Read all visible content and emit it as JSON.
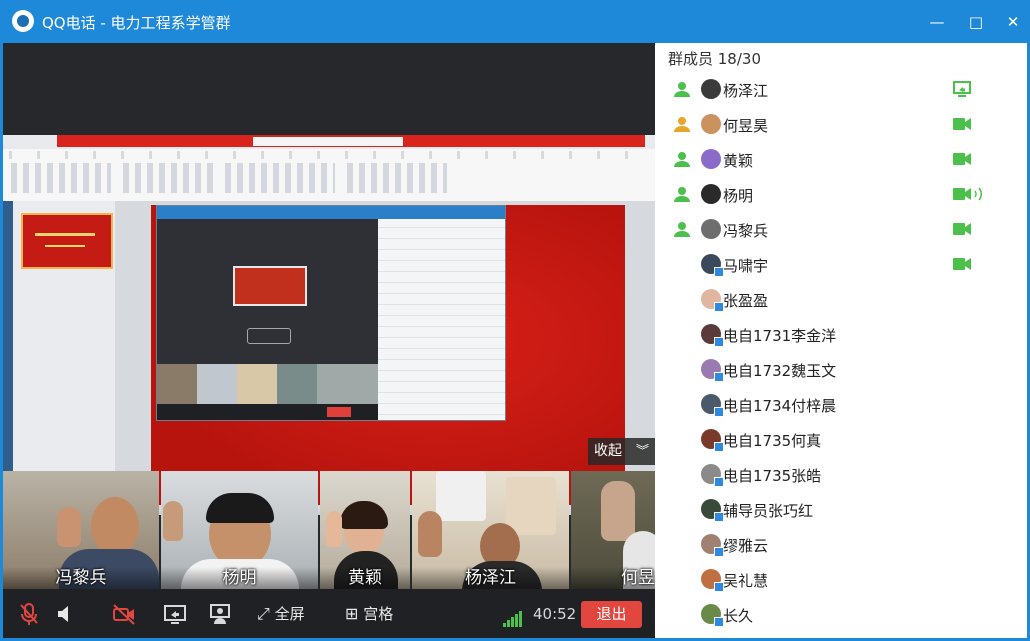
{
  "window": {
    "title": "QQ电话 - 电力工程系学管群",
    "buttons": {
      "minimize": "—",
      "maximize": "□",
      "close": "✕"
    }
  },
  "colors": {
    "accent": "#1d89d8",
    "exit": "#e2473f",
    "online_green": "#4bc14b",
    "away_orange": "#e7a52a"
  },
  "screen_share": {
    "collapse_label": "收起",
    "collapse_icon": "double-chevron-down-icon"
  },
  "video_tiles": [
    {
      "name": "冯黎兵"
    },
    {
      "name": "杨明"
    },
    {
      "name": "黄颖"
    },
    {
      "name": "杨泽江"
    },
    {
      "name": "何昱"
    }
  ],
  "controls": {
    "fullscreen_label": "全屏",
    "grid_label": "宫格",
    "timer": "40:52",
    "exit_label": "退出",
    "icons": [
      "mic-muted-icon",
      "speaker-icon",
      "camera-off-icon",
      "screen-share-icon",
      "presenter-icon",
      "fullscreen-icon",
      "grid-icon",
      "signal-icon"
    ]
  },
  "members": {
    "title": "群成员 18/30",
    "list": [
      {
        "name": "杨泽江",
        "presence": "online",
        "status": "screen-share-icon"
      },
      {
        "name": "何昱昊",
        "presence": "away",
        "status": "camera-icon"
      },
      {
        "name": "黄颖",
        "presence": "online",
        "status": "camera-icon"
      },
      {
        "name": "杨明",
        "presence": "online",
        "status": "camera-speaking-icon"
      },
      {
        "name": "冯黎兵",
        "presence": "online",
        "status": "camera-icon"
      },
      {
        "name": "马啸宇",
        "presence": "",
        "status": "camera-icon"
      },
      {
        "name": "张盈盈",
        "presence": "",
        "status": ""
      },
      {
        "name": "电自1731李金洋",
        "presence": "",
        "status": ""
      },
      {
        "name": "电自1732魏玉文",
        "presence": "",
        "status": ""
      },
      {
        "name": "电自1734付梓晨",
        "presence": "",
        "status": ""
      },
      {
        "name": "电自1735何真",
        "presence": "",
        "status": ""
      },
      {
        "name": "电自1735张皓",
        "presence": "",
        "status": ""
      },
      {
        "name": "辅导员张巧红",
        "presence": "",
        "status": ""
      },
      {
        "name": "缪雅云",
        "presence": "",
        "status": ""
      },
      {
        "name": "吴礼慧",
        "presence": "",
        "status": ""
      },
      {
        "name": "长久",
        "presence": "",
        "status": ""
      }
    ]
  }
}
